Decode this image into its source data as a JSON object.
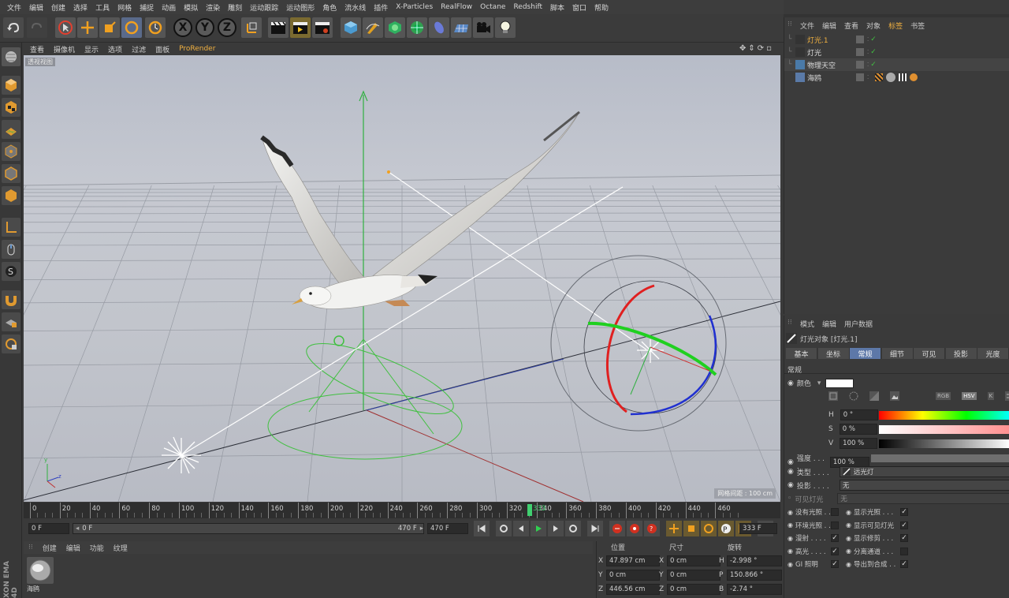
{
  "menubar": [
    "文件",
    "编辑",
    "创建",
    "选择",
    "工具",
    "网格",
    "捕捉",
    "动画",
    "模拟",
    "渲染",
    "雕刻",
    "运动跟踪",
    "运动图形",
    "角色",
    "流水线",
    "插件",
    "X-Particles",
    "RealFlow",
    "Octane",
    "Redshift",
    "脚本",
    "窗口",
    "帮助"
  ],
  "toolbar": {
    "x": "X",
    "y": "Y",
    "z": "Z"
  },
  "viewport": {
    "menu": [
      "查看",
      "摄像机",
      "显示",
      "选项",
      "过滤",
      "面板",
      "ProRender"
    ],
    "label": "透视视图",
    "grid_info": "网格间距 : 100 cm",
    "axes": {
      "y": "y",
      "z": "z"
    }
  },
  "timeline": {
    "ticks": [
      "0",
      "20",
      "40",
      "60",
      "80",
      "100",
      "120",
      "140",
      "160",
      "180",
      "200",
      "220",
      "240",
      "260",
      "280",
      "300",
      "320",
      "340",
      "360",
      "380",
      "400",
      "420",
      "440",
      "460"
    ],
    "current_label": "333",
    "current_frame": "333 F"
  },
  "transport": {
    "start": "0 F",
    "range_start": "0 F",
    "range_end": "470 F",
    "end": "470 F"
  },
  "material_manager": {
    "tabs": [
      "创建",
      "编辑",
      "功能",
      "纹理"
    ],
    "material_name": "海鸥"
  },
  "brand": "XON EMA 4D",
  "coords": {
    "headers": [
      "位置",
      "尺寸",
      "旋转"
    ],
    "rows": [
      {
        "axis": "X",
        "pos": "47.897 cm",
        "size_axis": "X",
        "size": "0 cm",
        "rot_axis": "H",
        "rot": "-2.998 °"
      },
      {
        "axis": "Y",
        "pos": "0 cm",
        "size_axis": "Y",
        "size": "0 cm",
        "rot_axis": "P",
        "rot": "150.866 °"
      },
      {
        "axis": "Z",
        "pos": "446.56 cm",
        "size_axis": "Z",
        "size": "0 cm",
        "rot_axis": "B",
        "rot": "-2.74 °"
      }
    ]
  },
  "object_manager": {
    "menu": [
      "文件",
      "编辑",
      "查看",
      "对象",
      "标签",
      "书签"
    ],
    "objects": [
      "灯光.1",
      "灯光",
      "物理天空",
      "海鸥"
    ]
  },
  "attribute_manager": {
    "menu": [
      "模式",
      "编辑",
      "用户数据"
    ],
    "object_title": "灯光对象 [灯光.1]",
    "tabs": [
      "基本",
      "坐标",
      "常规",
      "细节",
      "可见",
      "投影",
      "光度"
    ],
    "section": "常规",
    "color_label": "颜色",
    "color_value": "#ffffff",
    "color_modes": [
      "RGB",
      "HSV",
      "K"
    ],
    "h_label": "H",
    "h_value": "0 °",
    "s_label": "S",
    "s_value": "0 %",
    "v_label": "V",
    "v_value": "100 %",
    "intensity_label": "强度 . . . .",
    "intensity_value": "100 %",
    "type_label": "类型 . . . .",
    "type_value": "远光灯",
    "shadow_label": "投影 . . . .",
    "shadow_value": "无",
    "visible_light_label": "可见灯光",
    "visible_light_value": "无",
    "left_checks": [
      {
        "label": "没有光照 . .",
        "checked": false
      },
      {
        "label": "环境光照 . .",
        "checked": false
      },
      {
        "label": "漫射 . . . .",
        "checked": true
      },
      {
        "label": "高光 . . . .",
        "checked": true
      },
      {
        "label": "GI 照明",
        "checked": true
      }
    ],
    "right_checks": [
      {
        "label": "显示光照 . . .",
        "checked": true
      },
      {
        "label": "显示可见灯光",
        "checked": true
      },
      {
        "label": "显示修剪 . . .",
        "checked": true
      },
      {
        "label": "分离通道 . . .",
        "checked": false
      },
      {
        "label": "导出到合成 . .",
        "checked": true
      }
    ]
  }
}
